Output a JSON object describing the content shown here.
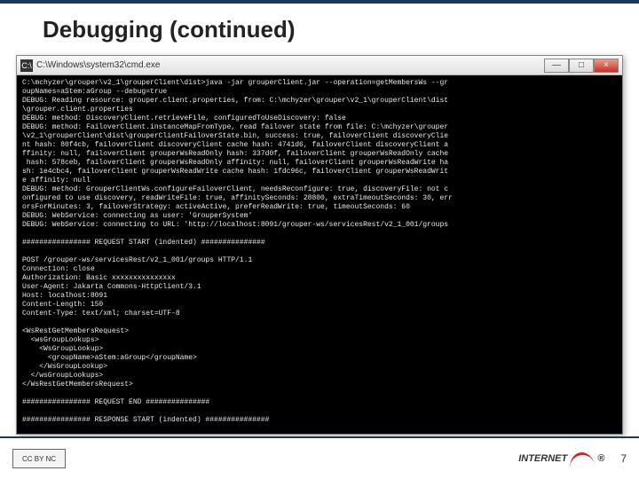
{
  "slide": {
    "title": "Debugging (continued)",
    "page_number": "7"
  },
  "window": {
    "title_prefix": "C:\\Windows\\system32\\cmd.exe",
    "icon_label": "C:\\",
    "buttons": {
      "min": "—",
      "max": "□",
      "close": "×"
    }
  },
  "footer": {
    "cc_label": "CC  BY  NC",
    "logo_text": "INTERNET",
    "logo_reg": "®"
  },
  "terminal_lines": [
    "C:\\mchyzer\\grouper\\v2_1\\grouperClient\\dist>java -jar grouperClient.jar --operation=getMembersWs --gr",
    "oupNames=aStem:aGroup --debug=true",
    "DEBUG: Reading resource: grouper.client.properties, from: C:\\mchyzer\\grouper\\v2_1\\grouperClient\\dist",
    "\\grouper.client.properties",
    "DEBUG: method: DiscoveryClient.retrieveFile, configuredToUseDiscovery: false",
    "DEBUG: method: FailoverClient.instanceMapFromType, read failover state from file: C:\\mchyzer\\grouper",
    "\\v2_1\\grouperClient\\dist\\grouperClientFailoverState.bin, success: true, failoverClient discoveryClie",
    "nt hash: 80f4cb, failoverClient discoveryClient cache hash: 4741d6, failoverClient discoveryClient a",
    "ffinity: null, failoverClient grouperWsReadOnly hash: 337d0f, failoverClient grouperWsReadOnly cache",
    " hash: 578ceb, failoverClient grouperWsReadOnly affinity: null, failoverClient grouperWsReadWrite ha",
    "sh: 1e4cbc4, failoverClient grouperWsReadWrite cache hash: 1fdc96c, failoverClient grouperWsReadWrit",
    "e affinity: null",
    "DEBUG: method: GrouperClientWs.configureFailoverClient, needsReconfigure: true, discoveryFile: not c",
    "onfigured to use discovery, readWriteFile: true, affinitySeconds: 28800, extraTimeoutSeconds: 30, err",
    "orsForMinutes: 3, failoverStrategy: activeActive, preferReadWrite: true, timeoutSeconds: 60",
    "DEBUG: WebService: connecting as user: 'GrouperSystem'",
    "DEBUG: WebService: connecting to URL: 'http://localhost:8091/grouper-ws/servicesRest/v2_1_001/groups",
    "",
    "################ REQUEST START (indented) ###############",
    "",
    "POST /grouper-ws/servicesRest/v2_1_001/groups HTTP/1.1",
    "Connection: close",
    "Authorization: Basic xxxxxxxxxxxxxxx",
    "User-Agent: Jakarta Commons-HttpClient/3.1",
    "Host: localhost:8091",
    "Content-Length: 150",
    "Content-Type: text/xml; charset=UTF-8",
    "",
    "<WsRestGetMembersRequest>",
    "  <wsGroupLookups>",
    "    <WsGroupLookup>",
    "      <groupName>aStem:aGroup</groupName>",
    "    </WsGroupLookup>",
    "  </wsGroupLookups>",
    "</WsRestGetMembersRequest>",
    "",
    "################ REQUEST END ###############",
    "",
    "################ RESPONSE START (indented) ###############"
  ]
}
